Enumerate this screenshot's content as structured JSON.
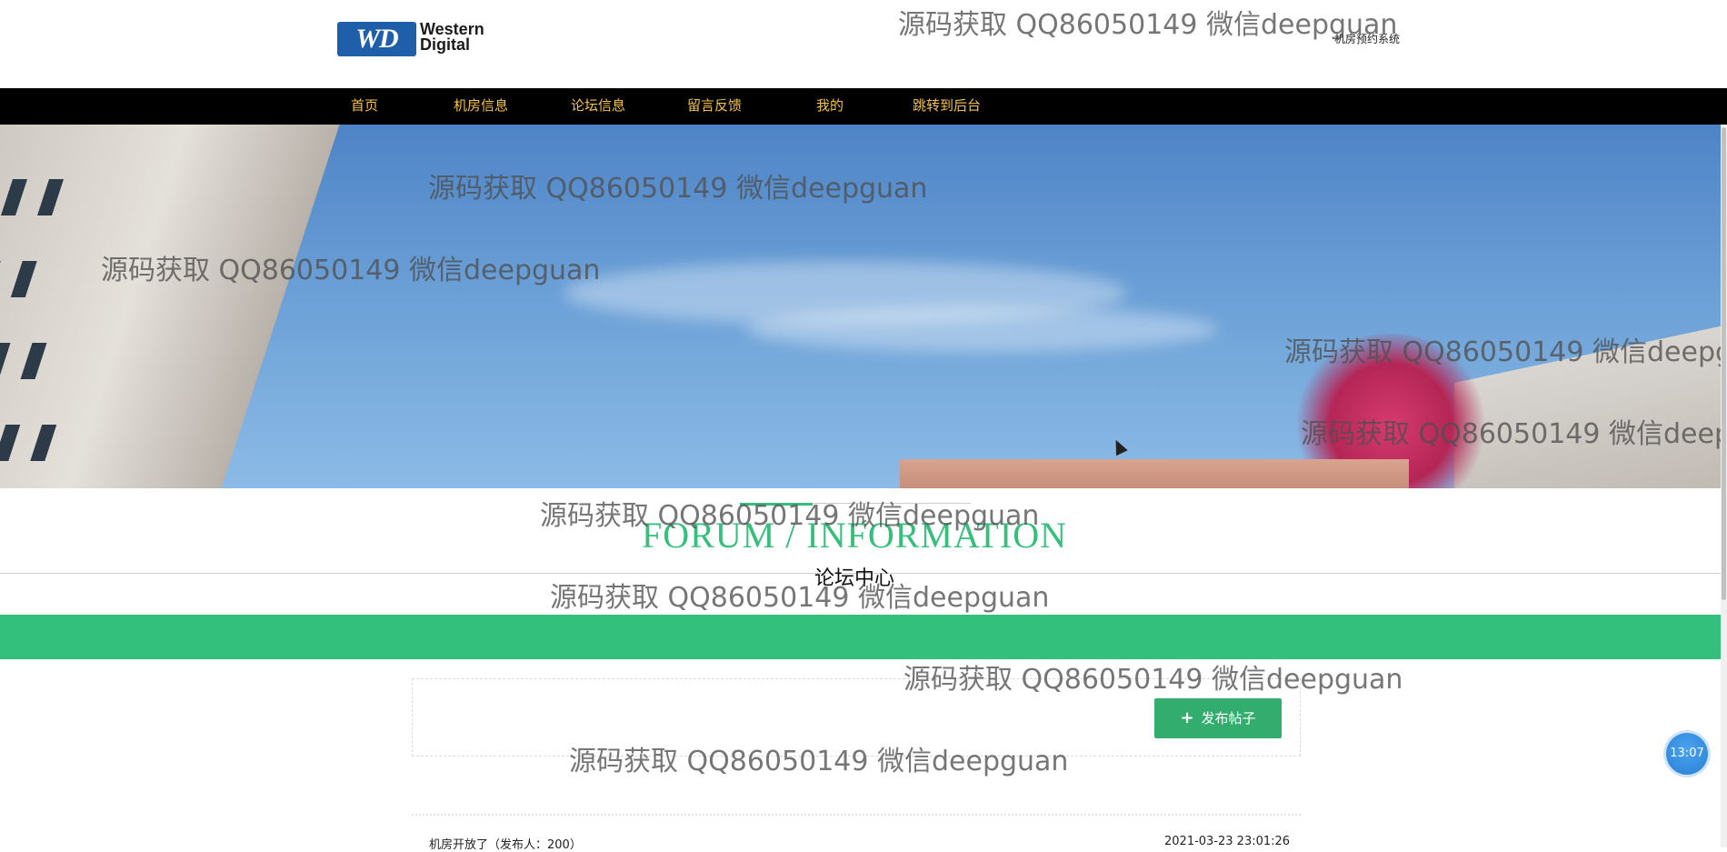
{
  "header": {
    "logo_mark": "WD",
    "logo_text_line1": "Western",
    "logo_text_line2": "Digital",
    "system_title": "机房预约系统"
  },
  "nav": {
    "items": [
      {
        "label": "首页"
      },
      {
        "label": "机房信息"
      },
      {
        "label": "论坛信息"
      },
      {
        "label": "留言反馈"
      },
      {
        "label": "我的"
      },
      {
        "label": "跳转到后台"
      }
    ]
  },
  "section": {
    "title": "FORUM / INFORMATION",
    "subtitle": "论坛中心"
  },
  "toolbar": {
    "publish_label": "发布帖子"
  },
  "posts": [
    {
      "title": "机房开放了（发布人：200）",
      "time": "2021-03-23 23:01:26"
    }
  ],
  "watermark": "源码获取 QQ86050149 微信deepguan",
  "clock": {
    "time": "13:07"
  },
  "colors": {
    "accent_green": "#33c07d",
    "nav_bg": "#000000",
    "nav_text": "#f5c24b",
    "brand_blue": "#1f5ea8"
  }
}
